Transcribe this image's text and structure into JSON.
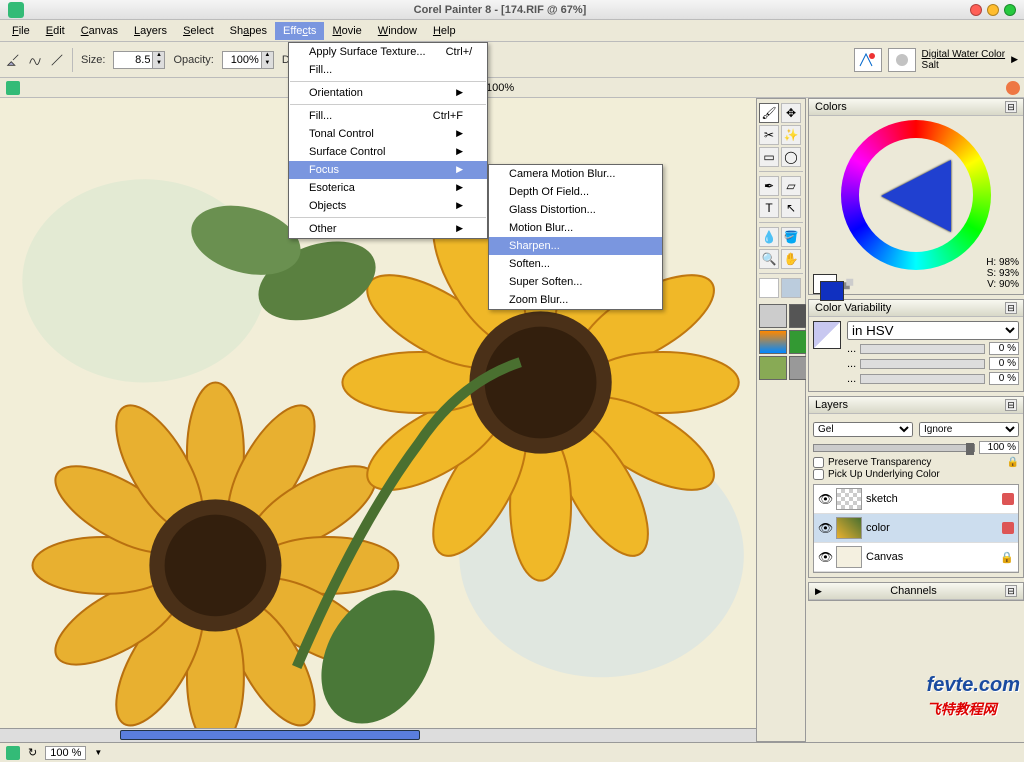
{
  "title": "Corel Painter 8 - [174.RIF @ 67%]",
  "menus": [
    "File",
    "Edit",
    "Canvas",
    "Layers",
    "Select",
    "Shapes",
    "Effects",
    "Movie",
    "Window",
    "Help"
  ],
  "open_menu_index": 6,
  "toolbar": {
    "size_label": "Size:",
    "size_value": "8.5",
    "opacity_label": "Opacity:",
    "opacity_value": "100%",
    "brush_category": "Digital Water Color",
    "brush_variant": "Salt"
  },
  "doc_zoom": "100%",
  "effects_menu": {
    "items": [
      {
        "label": "Apply Surface Texture...",
        "shortcut": "Ctrl+/"
      },
      {
        "label": "Fill..."
      },
      {
        "sep": true
      },
      {
        "label": "Orientation",
        "sub": true
      },
      {
        "sep": true
      },
      {
        "label": "Fill...",
        "shortcut": "Ctrl+F"
      },
      {
        "label": "Tonal Control",
        "sub": true
      },
      {
        "label": "Surface Control",
        "sub": true
      },
      {
        "label": "Focus",
        "sub": true,
        "hl": true
      },
      {
        "label": "Esoterica",
        "sub": true
      },
      {
        "label": "Objects",
        "sub": true
      },
      {
        "sep": true
      },
      {
        "label": "Other",
        "sub": true
      }
    ]
  },
  "focus_submenu": {
    "items": [
      {
        "label": "Camera Motion Blur..."
      },
      {
        "label": "Depth Of Field..."
      },
      {
        "label": "Glass Distortion..."
      },
      {
        "label": "Motion Blur..."
      },
      {
        "label": "Sharpen...",
        "hl": true
      },
      {
        "label": "Soften..."
      },
      {
        "label": "Super Soften..."
      },
      {
        "label": "Zoom Blur..."
      }
    ]
  },
  "colors_panel": {
    "title": "Colors",
    "H": "H: 98%",
    "S": "S: 93%",
    "V": "V: 90%"
  },
  "variability_panel": {
    "title": "Color Variability",
    "mode": "in HSV",
    "vals": [
      "0 %",
      "0 %",
      "0 %"
    ]
  },
  "layers_panel": {
    "title": "Layers",
    "blend": "Gel",
    "depth": "Ignore",
    "opacity": "100 %",
    "preserve": "Preserve Transparency",
    "pickup": "Pick Up Underlying Color",
    "layers": [
      {
        "name": "sketch",
        "sel": false
      },
      {
        "name": "color",
        "sel": true
      },
      {
        "name": "Canvas",
        "sel": false
      }
    ]
  },
  "channels_panel": {
    "title": "Channels"
  },
  "status": {
    "zoom": "100 %"
  },
  "watermark": {
    "domain": "fevte.com",
    "cn": "飞特教程网"
  }
}
